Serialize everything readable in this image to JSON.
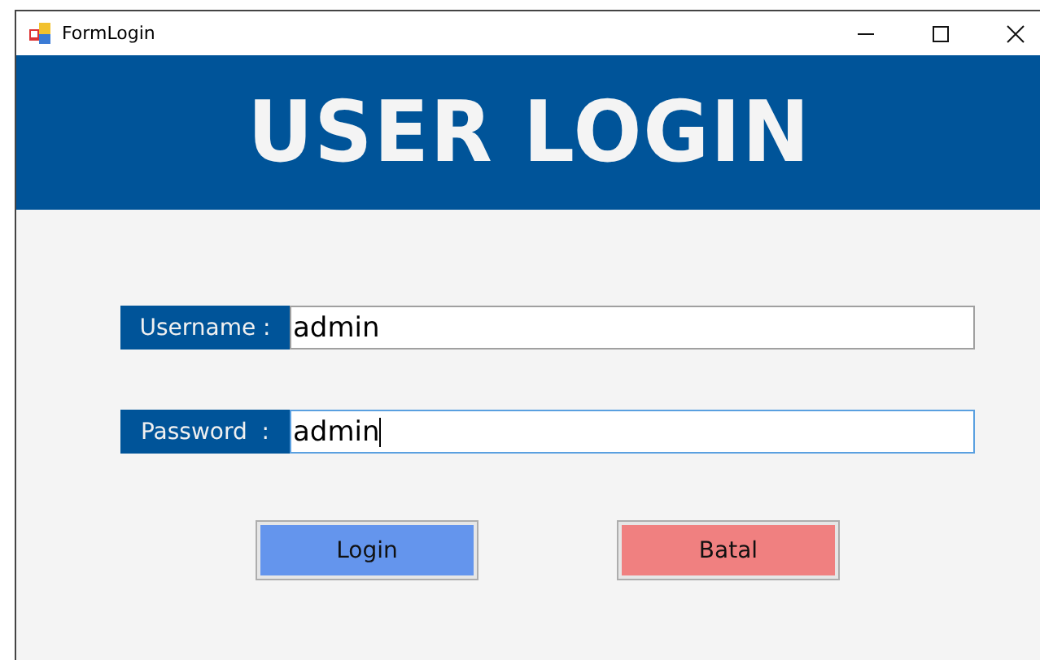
{
  "window": {
    "title": "FormLogin"
  },
  "header": {
    "title": "USER LOGIN"
  },
  "fields": [
    {
      "label": "Username :",
      "value": "admin",
      "focused": false
    },
    {
      "label": "Password  :",
      "value": "admin",
      "focused": true
    }
  ],
  "buttons": [
    {
      "label": "Login",
      "kind": "confirm"
    },
    {
      "label": "Batal",
      "kind": "cancel"
    }
  ]
}
